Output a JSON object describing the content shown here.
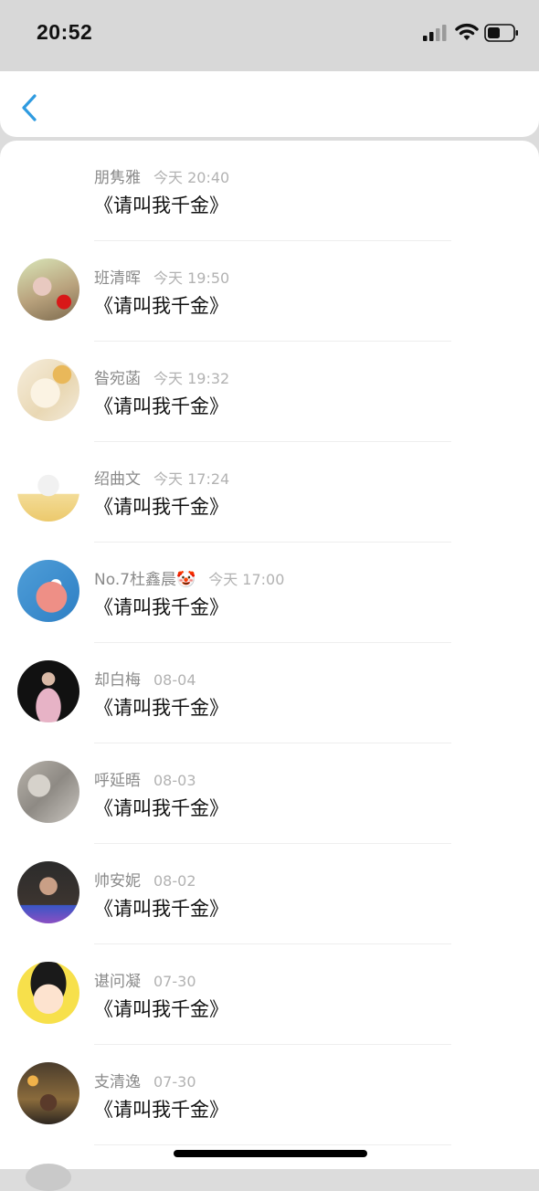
{
  "status_bar": {
    "time": "20:52"
  },
  "icons": {
    "back": "chevron-left-icon",
    "signal": "cellular-signal-icon",
    "wifi": "wifi-icon",
    "battery": "battery-icon"
  },
  "colors": {
    "accent": "#2f9be0"
  },
  "messages": [
    {
      "name": "朋隽雅",
      "time": "今天 20:40",
      "text": "《请叫我千金》",
      "avatar": "none"
    },
    {
      "name": "班清晖",
      "time": "今天 19:50",
      "text": "《请叫我千金》",
      "avatar": "photo-outdoor"
    },
    {
      "name": "昝宛菡",
      "time": "今天 19:32",
      "text": "《请叫我千金》",
      "avatar": "anime-girl"
    },
    {
      "name": "绍曲文",
      "time": "今天 17:24",
      "text": "《请叫我千金》",
      "avatar": "cartoon-cat-box"
    },
    {
      "name": "No.7杜鑫晨🤡",
      "time": "今天 17:00",
      "text": "《请叫我千金》",
      "avatar": "cartoon-starfish"
    },
    {
      "name": "却白梅",
      "time": "08-04",
      "text": "《请叫我千金》",
      "avatar": "photo-person-pink"
    },
    {
      "name": "呼延晤",
      "time": "08-03",
      "text": "《请叫我千金》",
      "avatar": "photo-grey"
    },
    {
      "name": "帅安妮",
      "time": "08-02",
      "text": "《请叫我千金》",
      "avatar": "photo-portrait"
    },
    {
      "name": "谌问凝",
      "time": "07-30",
      "text": "《请叫我千金》",
      "avatar": "cartoon-girl"
    },
    {
      "name": "支清逸",
      "time": "07-30",
      "text": "《请叫我千金》",
      "avatar": "photo-night"
    }
  ]
}
